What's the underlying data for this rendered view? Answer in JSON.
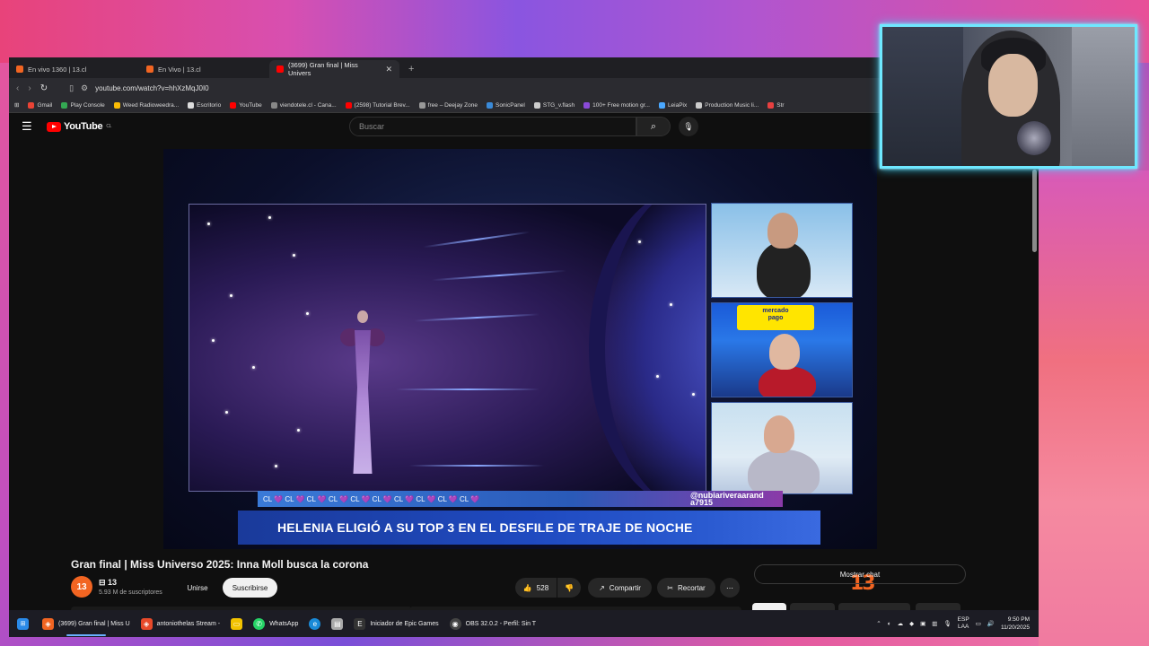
{
  "browser": {
    "tabs": [
      {
        "title": "En vivo 1360 | 13.cl",
        "fav_color": "#f26522",
        "active": false
      },
      {
        "title": "En Vivo | 13.cl",
        "fav_color": "#f26522",
        "active": false
      },
      {
        "title": "(3699) Gran final | Miss Univers",
        "fav_color": "#ff0000",
        "active": true
      }
    ],
    "url": "youtube.com/watch?v=hhXzMqJ0I0",
    "bookmarks": [
      {
        "label": "Gmail",
        "color": "#ea4335"
      },
      {
        "label": "Play Console",
        "color": "#34a853"
      },
      {
        "label": "Weed Radioweedra...",
        "color": "#fbbc05"
      },
      {
        "label": "Escritorio",
        "color": "#dddddd"
      },
      {
        "label": "YouTube",
        "color": "#ff0000"
      },
      {
        "label": "viendotele.cl - Cana...",
        "color": "#888888"
      },
      {
        "label": "(2598) Tutorial Brev...",
        "color": "#ff0000"
      },
      {
        "label": "free – Deejay Zone",
        "color": "#999999"
      },
      {
        "label": "SonicPanel",
        "color": "#3a8ad8"
      },
      {
        "label": "STG_v.flash",
        "color": "#cccccc"
      },
      {
        "label": "100+ Free motion gr...",
        "color": "#8a4ad8"
      },
      {
        "label": "LeiaPix",
        "color": "#4aa8ff"
      },
      {
        "label": "Production Music li...",
        "color": "#cccccc"
      },
      {
        "label": "Str",
        "color": "#e84040"
      }
    ]
  },
  "youtube": {
    "logo_text": "YouTube",
    "country": "CL",
    "search_placeholder": "Buscar",
    "video": {
      "ticker_text": "CL 💜 CL 💜 CL 💜 CL 💜 CL 💜 CL 💜 CL 💜 CL 💜 CL 💜 CL 💜",
      "handle_line1": "@nubiariveraarand",
      "handle_line2": "a7915",
      "lower_third": "HELENIA ELIGIÓ A SU TOP 3 EN EL DESFILE DE TRAJE DE NOCHE",
      "sponsor_top": "mercado",
      "sponsor_bottom": "pago",
      "network_logo": "13"
    },
    "title": "Gran final | Miss Universo 2025: Inna Moll busca la corona",
    "channel": {
      "avatar_text": "13",
      "name": "13",
      "subscribers": "5.93 M de suscriptores"
    },
    "join_label": "Unirse",
    "subscribe_label": "Suscribirse",
    "likes": "528",
    "share_label": "Compartir",
    "clip_label": "Recortar",
    "chat_label": "Mostrar chat"
  },
  "taskbar": {
    "items": [
      {
        "label": "(3699) Gran final | Miss U",
        "color": "#f26522",
        "active": true
      },
      {
        "label": "antoniothelas Stream - ",
        "color": "#e84a2a",
        "active": false
      },
      {
        "label": "",
        "color": "#f2c200",
        "active": false
      },
      {
        "label": "WhatsApp",
        "color": "#25d366",
        "active": false
      },
      {
        "label": "",
        "color": "#1a8ad8",
        "active": false
      },
      {
        "label": "",
        "color": "#aaaaaa",
        "active": false
      },
      {
        "label": "Iniciador de Epic Games",
        "color": "#333333",
        "active": false
      },
      {
        "label": "OBS 32.0.2 - Perfil: Sin T",
        "color": "#444444",
        "active": false
      }
    ],
    "lang_top": "ESP",
    "lang_bottom": "LAA",
    "time": "9:50 PM",
    "date": "11/20/2025"
  }
}
